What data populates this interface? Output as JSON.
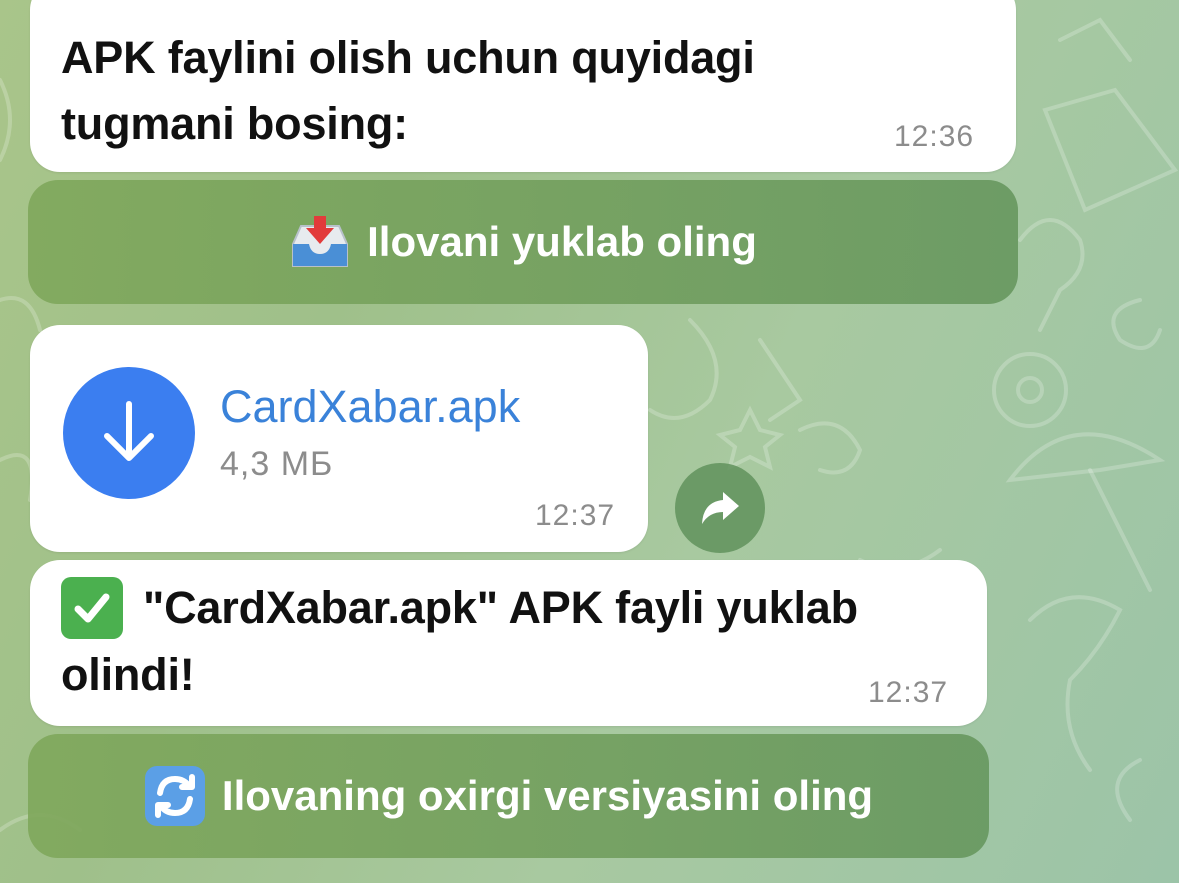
{
  "messages": {
    "m1": {
      "text_line1": "APK faylini olish uchun quyidagi",
      "text_line2": "tugmani bosing:",
      "time": "12:36"
    },
    "file": {
      "name": "CardXabar.apk",
      "size": "4,3 МБ",
      "time": "12:37"
    },
    "m3": {
      "text_line1": "\"CardXabar.apk\" APK fayli yuklab",
      "text_line2": "olindi!",
      "time": "12:37"
    }
  },
  "buttons": {
    "download": {
      "label": "Ilovani yuklab oling",
      "icon": "inbox-tray-icon"
    },
    "update": {
      "label": "Ilovaning oxirgi versiyasini oling",
      "icon": "arrows-cycle-icon"
    }
  },
  "icons": {
    "file": "download-arrow-icon",
    "share": "share-arrow-icon",
    "check": "check-mark-icon"
  },
  "colors": {
    "accent": "#3b7ef0",
    "link": "#3a82d9",
    "check": "#4bb04f"
  }
}
